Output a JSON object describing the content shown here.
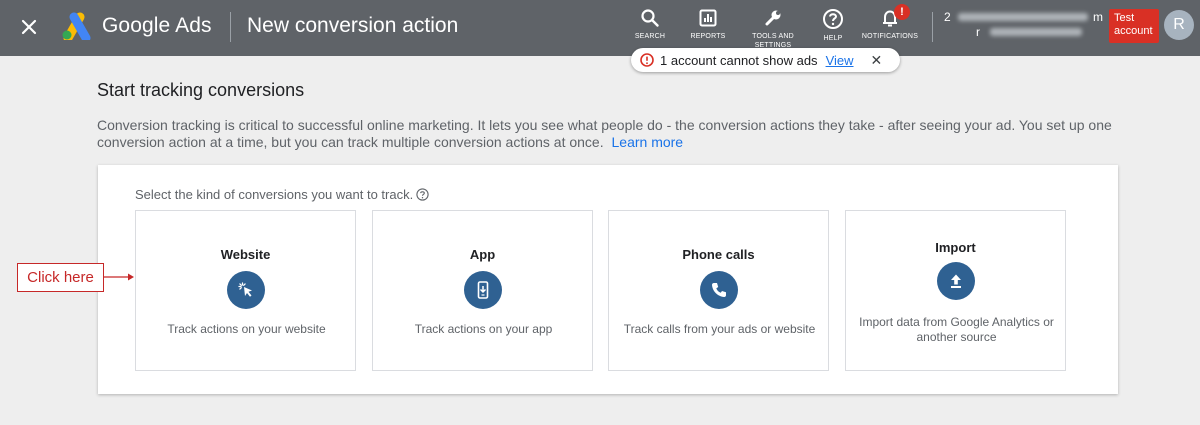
{
  "topbar": {
    "close_icon": "close-icon",
    "brand": "Google Ads",
    "title": "New conversion action",
    "tools": [
      {
        "icon": "search-icon",
        "label": "SEARCH"
      },
      {
        "icon": "reports-icon",
        "label": "REPORTS"
      },
      {
        "icon": "wrench-icon",
        "label": "TOOLS AND SETTINGS"
      },
      {
        "icon": "help-icon",
        "label": "HELP"
      },
      {
        "icon": "bell-icon",
        "label": "NOTIFICATIONS",
        "badge": "!"
      }
    ],
    "account": {
      "id_prefix": "2",
      "id_suffix": "m",
      "name_prefix": "r",
      "test_badge": "Test account",
      "avatar_letter": "R"
    }
  },
  "alert": {
    "text": "1 account cannot show ads",
    "link": "View"
  },
  "main": {
    "heading": "Start tracking conversions",
    "description": "Conversion tracking is critical to successful online marketing. It lets you see what people do - the conversion actions they take - after seeing your ad. You set up one conversion action at a time, but you can track multiple conversion actions at once.",
    "learn_more": "Learn more",
    "select_label": "Select the kind of conversions you want to track.",
    "cards": [
      {
        "title": "Website",
        "icon": "cursor-click-icon",
        "desc": "Track actions on your website"
      },
      {
        "title": "App",
        "icon": "mobile-app-icon",
        "desc": "Track actions on your app"
      },
      {
        "title": "Phone calls",
        "icon": "phone-icon",
        "desc": "Track calls from your ads or website"
      },
      {
        "title": "Import",
        "icon": "upload-icon",
        "desc": "Import data from Google Analytics or another source"
      }
    ]
  },
  "annotation": {
    "text": "Click here",
    "color": "#c62828"
  },
  "colors": {
    "topbar": "#5f6368",
    "link": "#1a73e8",
    "icon_circle": "#2f6192",
    "alert_red": "#d93025"
  }
}
